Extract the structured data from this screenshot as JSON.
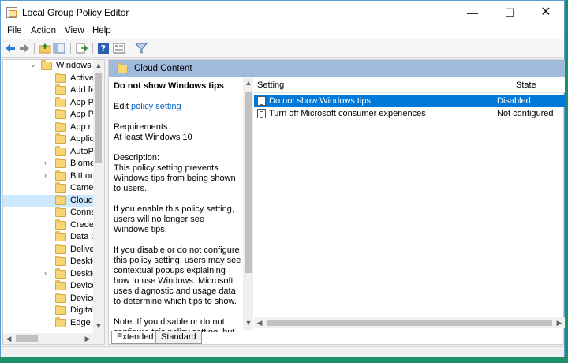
{
  "window": {
    "title": "Local Group Policy Editor",
    "minimize": "—",
    "maximize": "☐",
    "close": "✕"
  },
  "menu": [
    "File",
    "Action",
    "View",
    "Help"
  ],
  "toolbar_icons": [
    "back-icon",
    "forward-icon",
    "up-folder-icon",
    "show-hide-tree-icon",
    "export-list-icon",
    "help-icon",
    "properties-pane-icon",
    "filter-icon"
  ],
  "tree": {
    "items": [
      {
        "label": "Windows (",
        "expander": "⌄"
      },
      {
        "label": "ActiveX",
        "expander": ""
      },
      {
        "label": "Add fe",
        "expander": ""
      },
      {
        "label": "App Pa",
        "expander": ""
      },
      {
        "label": "App Pr",
        "expander": ""
      },
      {
        "label": "App ru",
        "expander": ""
      },
      {
        "label": "Applic",
        "expander": ""
      },
      {
        "label": "AutoPl",
        "expander": ""
      },
      {
        "label": "Biome",
        "expander": "›"
      },
      {
        "label": "BitLoc",
        "expander": "›"
      },
      {
        "label": "Camer",
        "expander": ""
      },
      {
        "label": "Cloud",
        "expander": ""
      },
      {
        "label": "Conne",
        "expander": ""
      },
      {
        "label": "Creder",
        "expander": ""
      },
      {
        "label": "Data C",
        "expander": ""
      },
      {
        "label": "Deliver",
        "expander": ""
      },
      {
        "label": "Deskto",
        "expander": ""
      },
      {
        "label": "Deskto",
        "expander": "›"
      },
      {
        "label": "Device",
        "expander": ""
      },
      {
        "label": "Device",
        "expander": ""
      },
      {
        "label": "Digital",
        "expander": ""
      },
      {
        "label": "Edge U",
        "expander": ""
      }
    ],
    "selected_index": 11
  },
  "panel": {
    "header": "Cloud Content",
    "description": {
      "title": "Do not show Windows tips",
      "edit_prefix": "Edit ",
      "edit_link": "policy setting",
      "requirements_label": "Requirements:",
      "requirements_value": "At least Windows 10",
      "description_label": "Description:",
      "para1": "This policy setting prevents Windows tips from being shown to users.",
      "para2": "If you enable this policy setting, users will no longer see Windows tips.",
      "para3": "If you disable or do not configure this policy setting, users may see contextual popups explaining how to use Windows. Microsoft uses diagnostic and usage data to determine which tips to show.",
      "para4": "Note: If you disable or do not configure this policy setting, but"
    },
    "columns": {
      "setting": "Setting",
      "state": "State"
    },
    "rows": [
      {
        "setting": "Do not show Windows tips",
        "state": "Disabled",
        "selected": true
      },
      {
        "setting": "Turn off Microsoft consumer experiences",
        "state": "Not configured",
        "selected": false
      }
    ],
    "tabs": [
      "Extended",
      "Standard"
    ],
    "active_tab": "Extended"
  }
}
